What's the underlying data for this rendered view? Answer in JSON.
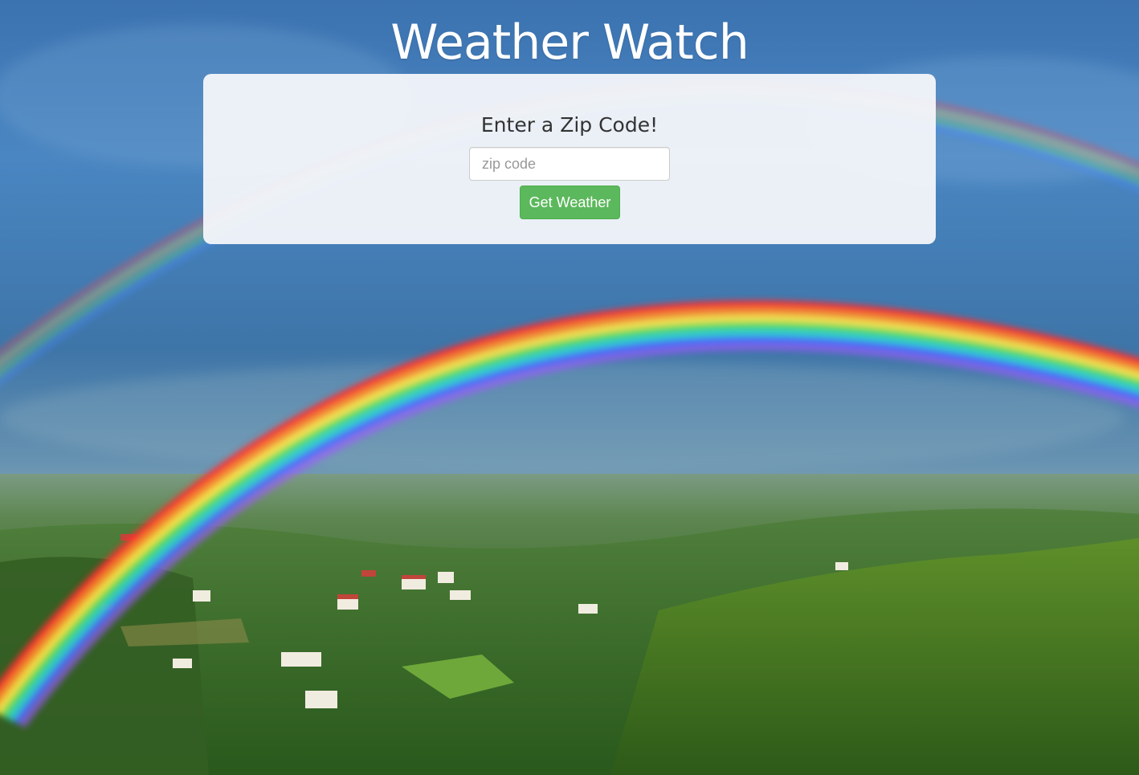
{
  "header": {
    "title": "Weather Watch"
  },
  "form": {
    "prompt": "Enter a Zip Code!",
    "zip_placeholder": "zip code",
    "zip_value": "",
    "submit_label": "Get Weather"
  },
  "colors": {
    "title_text": "#ffffff",
    "card_background": "#f4f6fa",
    "button_background": "#5cb85c",
    "button_text": "#ffffff"
  },
  "background": {
    "image_subject": "rainbow-over-green-valley"
  }
}
